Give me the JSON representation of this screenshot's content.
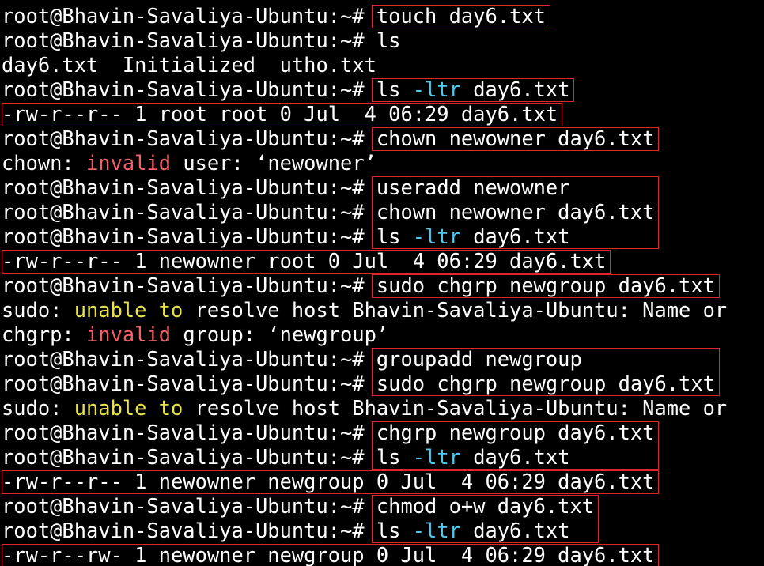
{
  "terminal": {
    "prompt": "root@Bhavin-Savaliya-Ubuntu:~# ",
    "lines": [
      {
        "kind": "prompt",
        "segments": [
          {
            "text": "touch day6.txt"
          }
        ]
      },
      {
        "kind": "prompt",
        "segments": [
          {
            "text": "ls"
          }
        ]
      },
      {
        "kind": "output",
        "segments": [
          {
            "text": "day6.txt  Initialized  utho.txt"
          }
        ]
      },
      {
        "kind": "prompt",
        "segments": [
          {
            "text": "ls "
          },
          {
            "text": "-ltr",
            "style": "flag"
          },
          {
            "text": " day6.txt"
          }
        ]
      },
      {
        "kind": "output",
        "segments": [
          {
            "text": "-rw-r--r-- 1 root root 0 Jul  4 06:29 day6.txt"
          }
        ]
      },
      {
        "kind": "prompt",
        "segments": [
          {
            "text": "chown newowner day6.txt"
          }
        ]
      },
      {
        "kind": "output",
        "segments": [
          {
            "text": "chown: "
          },
          {
            "text": "invalid",
            "style": "err"
          },
          {
            "text": " user: ‘newowner’"
          }
        ]
      },
      {
        "kind": "prompt",
        "segments": [
          {
            "text": "useradd newowner"
          }
        ]
      },
      {
        "kind": "prompt",
        "segments": [
          {
            "text": "chown newowner day6.txt"
          }
        ]
      },
      {
        "kind": "prompt",
        "segments": [
          {
            "text": "ls "
          },
          {
            "text": "-ltr",
            "style": "flag"
          },
          {
            "text": " day6.txt"
          }
        ]
      },
      {
        "kind": "output",
        "segments": [
          {
            "text": "-rw-r--r-- 1 newowner root 0 Jul  4 06:29 day6.txt"
          }
        ]
      },
      {
        "kind": "prompt",
        "segments": [
          {
            "text": "sudo chgrp newgroup day6.txt"
          }
        ]
      },
      {
        "kind": "output",
        "segments": [
          {
            "text": "sudo: "
          },
          {
            "text": "unable to",
            "style": "warn"
          },
          {
            "text": " resolve host Bhavin-Savaliya-Ubuntu: Name or"
          }
        ]
      },
      {
        "kind": "output",
        "segments": [
          {
            "text": "chgrp: "
          },
          {
            "text": "invalid",
            "style": "err"
          },
          {
            "text": " group: ‘newgroup’"
          }
        ]
      },
      {
        "kind": "prompt",
        "segments": [
          {
            "text": "groupadd newgroup"
          }
        ]
      },
      {
        "kind": "prompt",
        "segments": [
          {
            "text": "sudo chgrp newgroup day6.txt"
          }
        ]
      },
      {
        "kind": "output",
        "segments": [
          {
            "text": "sudo: "
          },
          {
            "text": "unable to",
            "style": "warn"
          },
          {
            "text": " resolve host Bhavin-Savaliya-Ubuntu: Name or"
          }
        ]
      },
      {
        "kind": "prompt",
        "segments": [
          {
            "text": "chgrp newgroup day6.txt"
          }
        ]
      },
      {
        "kind": "prompt",
        "segments": [
          {
            "text": "ls "
          },
          {
            "text": "-ltr",
            "style": "flag"
          },
          {
            "text": " day6.txt"
          }
        ]
      },
      {
        "kind": "output",
        "segments": [
          {
            "text": "-rw-r--r-- 1 newowner newgroup 0 Jul  4 06:29 day6.txt"
          }
        ]
      },
      {
        "kind": "prompt",
        "segments": [
          {
            "text": "chmod o+w day6.txt"
          }
        ]
      },
      {
        "kind": "prompt",
        "segments": [
          {
            "text": "ls "
          },
          {
            "text": "-ltr",
            "style": "flag"
          },
          {
            "text": " day6.txt"
          }
        ]
      },
      {
        "kind": "output",
        "segments": [
          {
            "text": "-rw-r--rw- 1 newowner newgroup 0 Jul  4 06:29 day6.txt"
          }
        ]
      }
    ]
  },
  "colors": {
    "background": "#000000",
    "text": "#ffffff",
    "flag": "#4ec9f0",
    "error": "#f25f67",
    "warning": "#e8e34a",
    "highlight_box": "#e0262c"
  }
}
